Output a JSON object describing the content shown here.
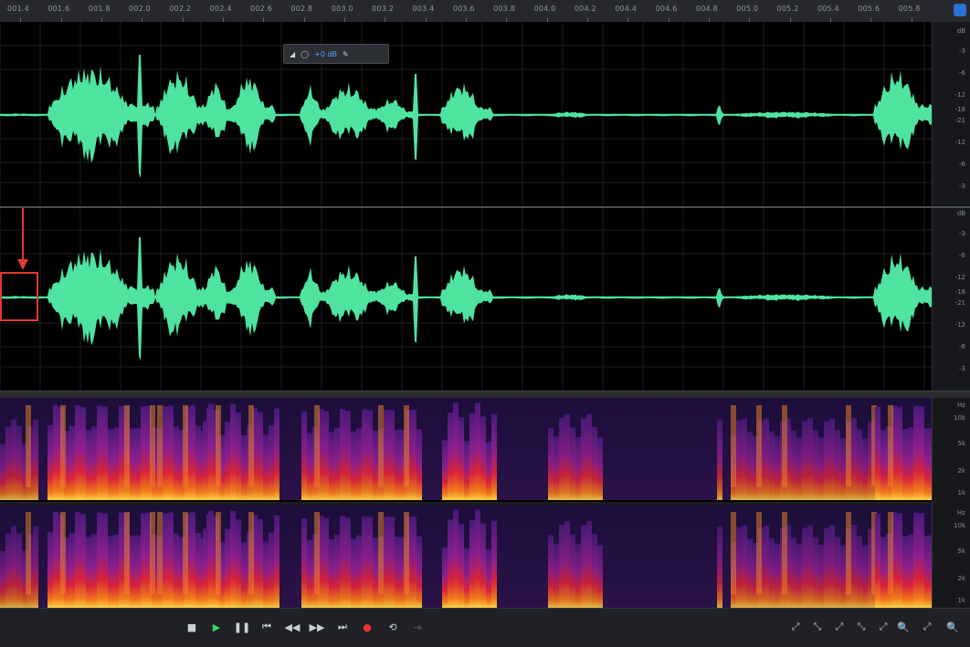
{
  "ruler": {
    "labels": [
      "001.4",
      "001.6",
      "001.8",
      "002.0",
      "002.2",
      "002.4",
      "002.6",
      "002.8",
      "003.0",
      "003.2",
      "003.4",
      "003.6",
      "003.8",
      "004.0",
      "004.2",
      "004.4",
      "004.6",
      "004.8",
      "005.0",
      "005.2",
      "005.4",
      "005.6",
      "005.8"
    ]
  },
  "hud": {
    "db_value": "+0 dB"
  },
  "db_scale": {
    "labels": [
      "dB",
      "-3",
      "-6",
      "-12",
      "-18",
      "-21",
      "-12",
      "-6",
      "-3"
    ]
  },
  "hz_scale": {
    "top_labels": [
      "Hz",
      "10k",
      "5k",
      "2k",
      "1k"
    ],
    "bottom_labels": [
      "Hz",
      "10k",
      "5k",
      "2k",
      "1k"
    ]
  },
  "colors": {
    "waveform": "#4fe3a0",
    "selection": "#e03a2f",
    "play": "#37d46a",
    "record": "#e33333",
    "accent": "#2d6fd6"
  },
  "transport": {
    "stop_icon": "■",
    "play_icon": "▶",
    "pause_icon": "❚❚",
    "to_start_icon": "⏮",
    "rewind_icon": "◀◀",
    "forward_icon": "▶▶",
    "to_end_icon": "⏭",
    "record_icon": "●",
    "loop_icon": "⟲",
    "skip_icon": "⇥"
  },
  "zoom": {
    "icons": [
      "⤢",
      "⤡",
      "⤢",
      "⤡",
      "⤢",
      "🔍",
      "⤢",
      "🔍"
    ]
  }
}
